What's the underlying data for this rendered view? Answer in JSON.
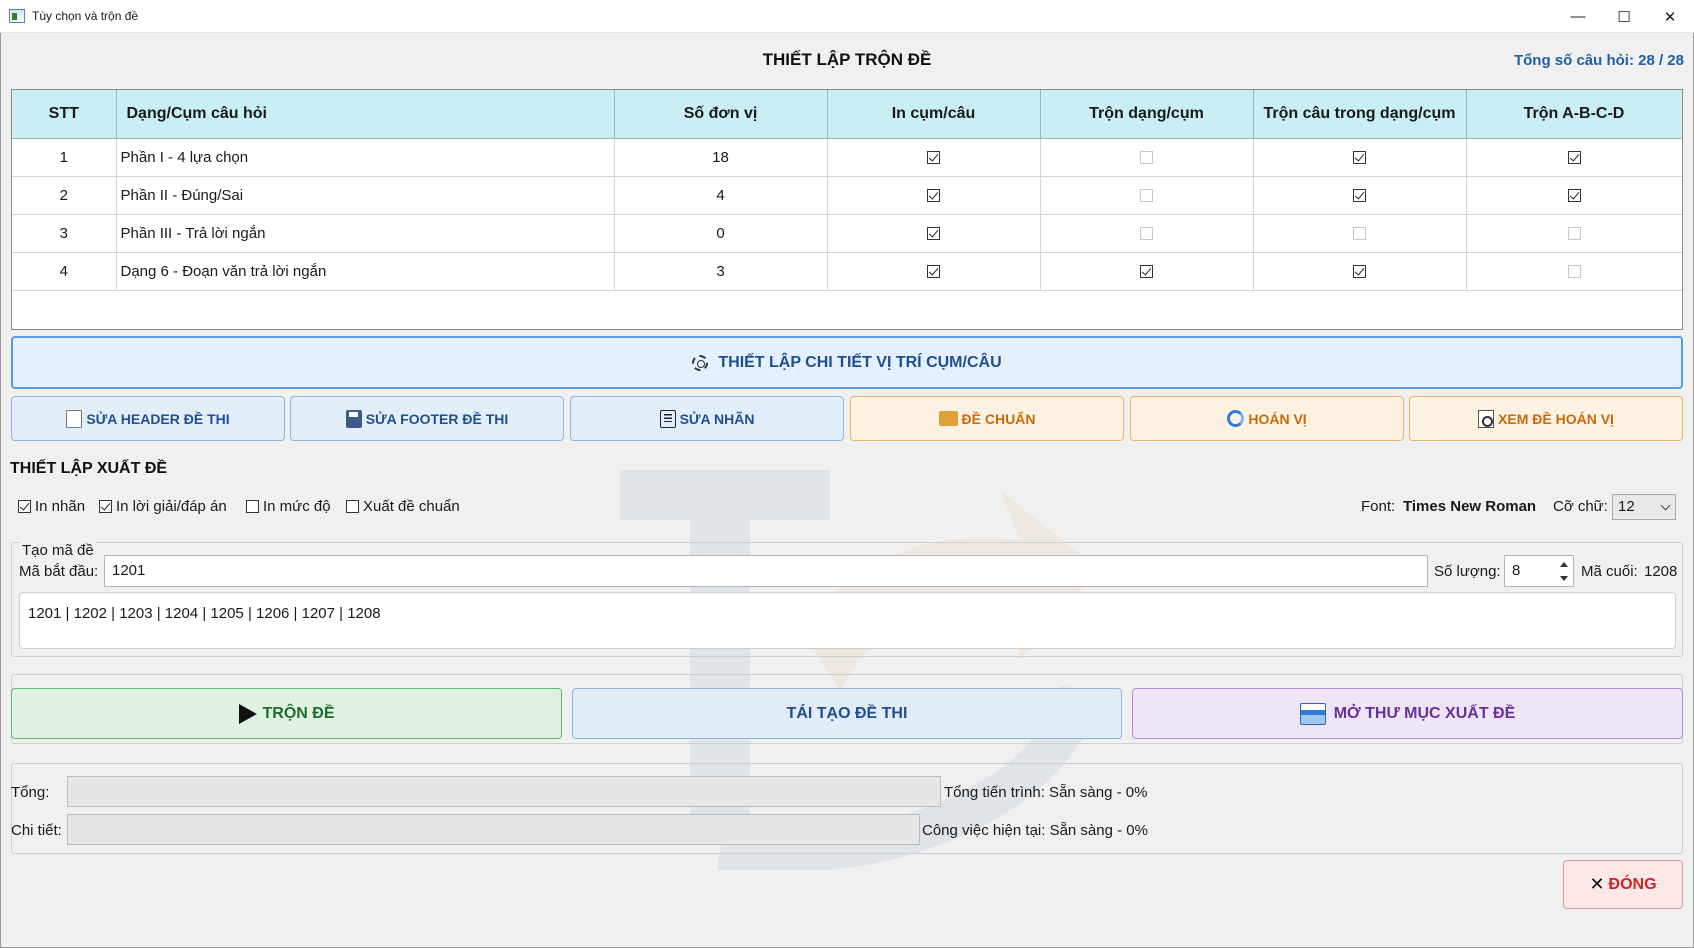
{
  "window": {
    "title": "Tùy chọn và trộn đề",
    "minimize_glyph": "—",
    "maximize_glyph": "☐",
    "close_glyph": "✕"
  },
  "header": {
    "title": "THIẾT LẬP TRỘN ĐỀ",
    "total_count": "Tổng số câu hỏi: 28 / 28"
  },
  "grid": {
    "columns": [
      "STT",
      "Dạng/Cụm câu hỏi",
      "Số đơn vị",
      "In cụm/câu",
      "Trộn dạng/cụm",
      "Trộn câu trong dạng/cụm",
      "Trộn A-B-C-D"
    ],
    "rows": [
      {
        "stt": "1",
        "name": "Phần I - 4 lựa chọn",
        "units": "18",
        "print": true,
        "shuffle_group": false,
        "shuffle_in_group": true,
        "shuffle_abcd": true,
        "shuffle_abcd_enabled": true
      },
      {
        "stt": "2",
        "name": "Phần II - Đúng/Sai",
        "units": "4",
        "print": true,
        "shuffle_group": false,
        "shuffle_in_group": true,
        "shuffle_abcd": true,
        "shuffle_abcd_enabled": true
      },
      {
        "stt": "3",
        "name": "Phần III - Trả lời ngắn",
        "units": "0",
        "print": true,
        "shuffle_group": false,
        "shuffle_in_group": false,
        "shuffle_abcd": false,
        "shuffle_abcd_enabled": false
      },
      {
        "stt": "4",
        "name": "Dạng 6 - Đoạn văn trả lời ngắn",
        "units": "3",
        "print": true,
        "shuffle_group": true,
        "shuffle_in_group": true,
        "shuffle_abcd": false,
        "shuffle_abcd_enabled": false
      }
    ]
  },
  "detail_button": {
    "label": "THIẾT LẬP CHI TIẾT VỊ TRÍ CỤM/CÂU"
  },
  "toolbar": {
    "edit_header": "SỬA HEADER ĐỀ THI",
    "edit_footer": "SỬA FOOTER ĐỀ THI",
    "edit_label": "SỬA NHÃN",
    "standard_exam": "ĐỀ CHUẨN",
    "permute": "HOÁN VỊ",
    "view_permuted": "XEM ĐỀ HOÁN VỊ"
  },
  "export": {
    "section_title": "THIẾT LẬP XUẤT ĐỀ",
    "options": [
      {
        "label": "In nhãn",
        "checked": true
      },
      {
        "label": "In lời giải/đáp án",
        "checked": true
      },
      {
        "label": "In mức độ",
        "checked": false
      },
      {
        "label": "Xuất đề chuẩn",
        "checked": false
      }
    ],
    "font_label": "Font:",
    "font_value": "Times New Roman",
    "size_label": "Cỡ chữ:",
    "size_value": "12"
  },
  "code_group": {
    "title": "Tạo mã đề",
    "start_label": "Mã bắt đầu:",
    "start_value": "1201",
    "qty_label": "Số lượng:",
    "qty_value": "8",
    "last_label": "Mã cuối:",
    "last_value": "1208",
    "codes": "1201 | 1202 | 1203 | 1204 | 1205 | 1206 | 1207 | 1208"
  },
  "actions": {
    "mix": "TRỘN ĐỀ",
    "regenerate": "TÁI TẠO ĐỀ THI",
    "open_folder": "MỞ THƯ MỤC XUẤT ĐỀ"
  },
  "progress": {
    "total_label": "Tổng:",
    "total_text": "Tổng tiến trình: Sẵn sàng - 0%",
    "total_value": 0,
    "detail_label": "Chi tiết:",
    "detail_text": "Công việc hiện tại: Sẵn sàng - 0%",
    "detail_value": 0
  },
  "close_button": {
    "label": "ĐÓNG",
    "glyph": "✕"
  }
}
